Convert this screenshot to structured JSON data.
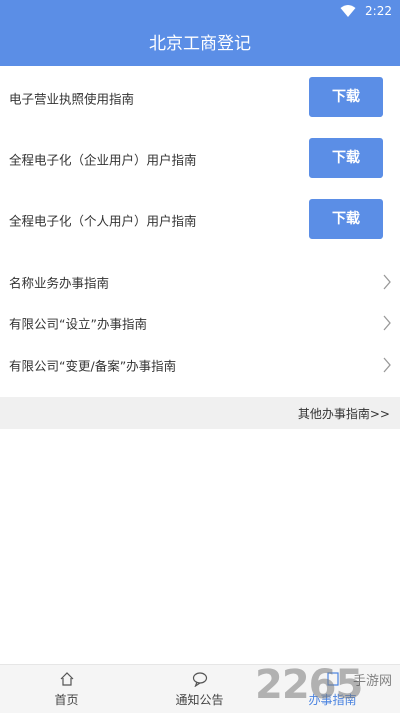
{
  "status_bar": {
    "time": "2:22",
    "icons": [
      "wifi-icon"
    ]
  },
  "header": {
    "title": "北京工商登记"
  },
  "download_items": [
    {
      "label": "电子营业执照使用指南",
      "button": "下载"
    },
    {
      "label": "全程电子化（企业用户）用户指南",
      "button": "下载"
    },
    {
      "label": "全程电子化（个人用户）用户指南",
      "button": "下载"
    }
  ],
  "guide_items": [
    {
      "label": "名称业务办事指南",
      "icon": "chevron-right-icon"
    },
    {
      "label": "有限公司“设立”办事指南",
      "icon": "chevron-right-icon"
    },
    {
      "label": "有限公司“变更/备案”办事指南",
      "icon": "chevron-right-icon"
    }
  ],
  "other_link": "其他办事指南>>",
  "tabs": [
    {
      "label": "首页",
      "icon": "home-icon"
    },
    {
      "label": "通知公告",
      "icon": "chat-bubble-icon"
    },
    {
      "label": "办事指南",
      "icon": "guide-icon",
      "active": true
    }
  ],
  "watermark": {
    "number": "2265",
    "site": "手游网"
  },
  "colors": {
    "primary": "#5b8ee6",
    "active_tab": "#4a83e0",
    "separator_bar": "#f0f0f0"
  }
}
